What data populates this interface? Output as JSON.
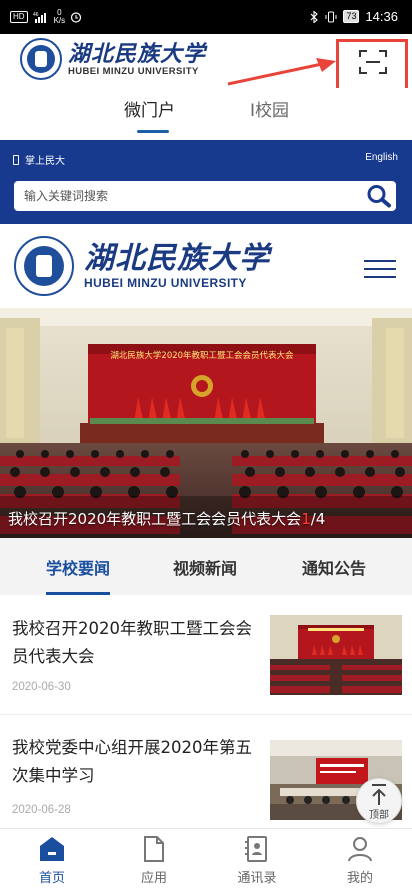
{
  "status_bar": {
    "network": "HD",
    "signal_type": "46",
    "speed_value": "0",
    "speed_unit": "K/s",
    "battery": "73",
    "time": "14:36"
  },
  "app_header": {
    "logo_cn": "湖北民族大学",
    "logo_en": "HUBEI MINZU UNIVERSITY",
    "scan_icon": "scan-icon",
    "highlight_color": "#e8443a"
  },
  "tabs": [
    {
      "label": "微门户",
      "active": true
    },
    {
      "label": "I校园",
      "active": false
    }
  ],
  "banner": {
    "mobile_label": "掌上民大",
    "english_label": "English",
    "search_placeholder": "输入关键词搜索",
    "color": "#17398e"
  },
  "site_header": {
    "logo_cn": "湖北民族大学",
    "logo_en": "HUBEI MINZU UNIVERSITY",
    "menu_icon": "hamburger-icon"
  },
  "slideshow": {
    "caption": "我校召开2020年教职工暨工会会员代表大会",
    "current": "1",
    "total": "/4",
    "stage_banner": "湖北民族大学2020年教职工暨工会会员代表大会"
  },
  "news_tabs": [
    {
      "label": "学校要闻",
      "active": true
    },
    {
      "label": "视频新闻",
      "active": false
    },
    {
      "label": "通知公告",
      "active": false
    }
  ],
  "news": [
    {
      "title": "我校召开2020年教职工暨工会会员代表大会",
      "date": "2020-06-30"
    },
    {
      "title": "我校党委中心组开展2020年第五次集中学习",
      "date": "2020-06-28"
    }
  ],
  "back_to_top": "顶部",
  "bottom_nav": [
    {
      "label": "首页",
      "icon": "home-icon",
      "active": true
    },
    {
      "label": "应用",
      "icon": "document-icon",
      "active": false
    },
    {
      "label": "通讯录",
      "icon": "contacts-icon",
      "active": false
    },
    {
      "label": "我的",
      "icon": "user-icon",
      "active": false
    }
  ],
  "accent_color": "#1a4fa0"
}
